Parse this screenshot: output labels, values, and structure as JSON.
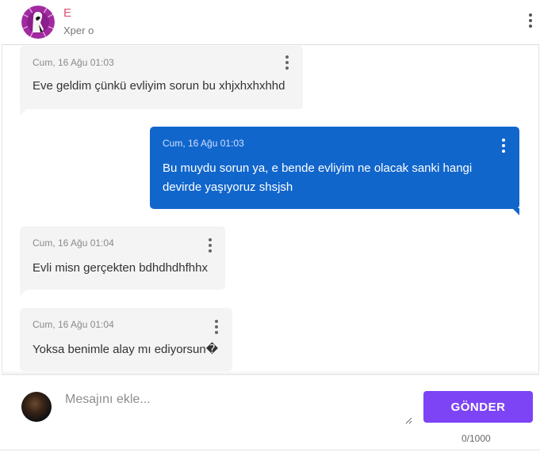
{
  "header": {
    "name": "E",
    "subtitle": "Xper o"
  },
  "messages": [
    {
      "direction": "in",
      "timestamp": "Cum, 16 Ağu 01:03",
      "lines": [
        "Eve geldim çünkü evliyim sorun bu xhjxhxhxhhd"
      ]
    },
    {
      "direction": "out",
      "timestamp": "Cum, 16 Ağu 01:03",
      "lines": [
        "Bu muydu sorun ya, e bende evliyim ne olacak sanki hangi",
        "devirde yaşıyoruz shsjsh"
      ]
    },
    {
      "direction": "in",
      "timestamp": "Cum, 16 Ağu 01:04",
      "lines": [
        "Evli misn gerçekten bdhdhdhfhhx"
      ]
    },
    {
      "direction": "in",
      "timestamp": "Cum, 16 Ağu 01:04",
      "lines": [
        "Yoksa benimle alay mı ediyorsun�"
      ]
    }
  ],
  "composer": {
    "placeholder": "Mesajını ekle...",
    "send_label": "GÖNDER",
    "counter": "0/1000"
  },
  "colors": {
    "accent": "#7c44f5",
    "outgoing_bubble": "#1166cc",
    "incoming_bubble": "#f4f4f4",
    "header_name": "#e0507a"
  },
  "icons": {
    "message_menu": "kebab-vertical-icon",
    "header_menu": "kebab-vertical-icon"
  }
}
